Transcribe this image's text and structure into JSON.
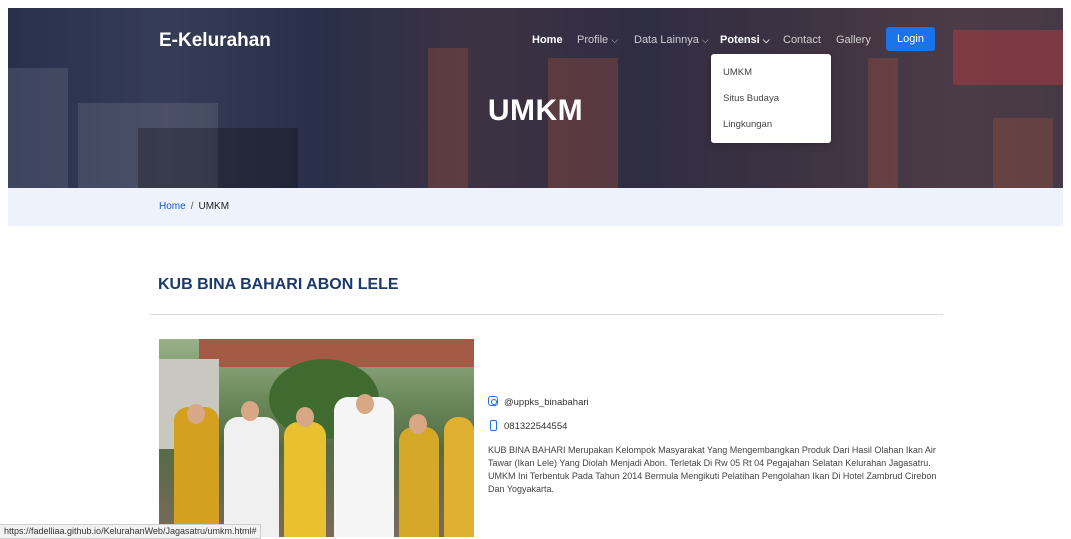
{
  "brand": "E-Kelurahan",
  "nav": {
    "home": "Home",
    "profile": "Profile",
    "data_lainnya": "Data Lainnya",
    "potensi": "Potensi",
    "contact": "Contact",
    "gallery": "Gallery",
    "login": "Login",
    "chevron": "⌵"
  },
  "dropdown": {
    "items": [
      "UMKM",
      "Situs Budaya",
      "Lingkungan"
    ]
  },
  "hero": {
    "title": "UMKM"
  },
  "breadcrumb": {
    "home": "Home",
    "sep": "/",
    "current": "UMKM"
  },
  "umkm": {
    "title": "KUB BINA BAHARI ABON LELE",
    "instagram": "@uppks_binabahari",
    "phone": "081322544554",
    "description": "KUB BINA BAHARI Merupakan Kelompok Masyarakat Yang Mengembangkan Produk Dari Hasil Olahan Ikan Air Tawar (Ikan Lele) Yang Diolah Menjadi Abon. Terletak Di Rw 05 Rt 04 Pegajahan Selatan Kelurahan Jagasatru. UMKM Ini Terbentuk Pada Tahun 2014 Bermula Mengikuti Pelatihan Pengolahan Ikan Di Hotel Zambrud Cirebon Dan Yogyakarta."
  },
  "status_url": "https://fadelliaa.github.io/KelurahanWeb/Jagasatru/umkm.html#",
  "colors": {
    "accent": "#1a73e8",
    "title": "#1a3a6e",
    "crumb_bg": "#eef3fb"
  }
}
